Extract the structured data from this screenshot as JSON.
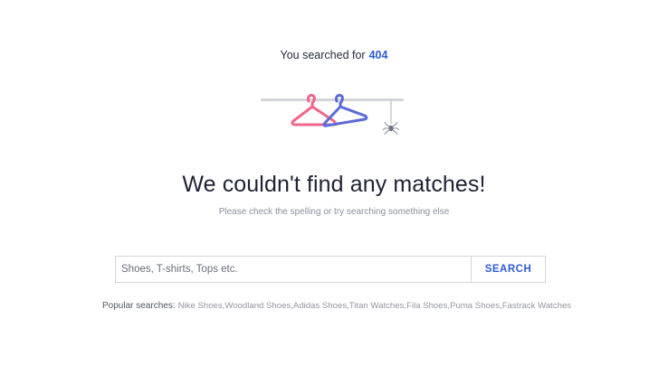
{
  "summary": {
    "prefix": "You searched for",
    "term": "404"
  },
  "illustration": {
    "icon": "clothes-hanger-rack-icon",
    "hanger_colors": [
      "#f1658a",
      "#5a6bd7"
    ],
    "rail_color": "#d4d5d9",
    "spider_icon": "spider-icon"
  },
  "headline": "We couldn't find any matches!",
  "subtext": "Please check the spelling or try searching something else",
  "search": {
    "placeholder": "Shoes, T-shirts, Tops etc.",
    "value": "",
    "button_label": "SEARCH"
  },
  "popular": {
    "label": "Popular searches:",
    "items": [
      "Nike Shoes",
      "Woodland Shoes",
      "Adidas Shoes",
      "Titan Watches",
      "Fila Shoes",
      "Puma Shoes",
      "Fastrack Watches"
    ]
  },
  "colors": {
    "accent": "#2d5bd6",
    "text": "#282c3f",
    "muted": "#8c8f9c"
  }
}
